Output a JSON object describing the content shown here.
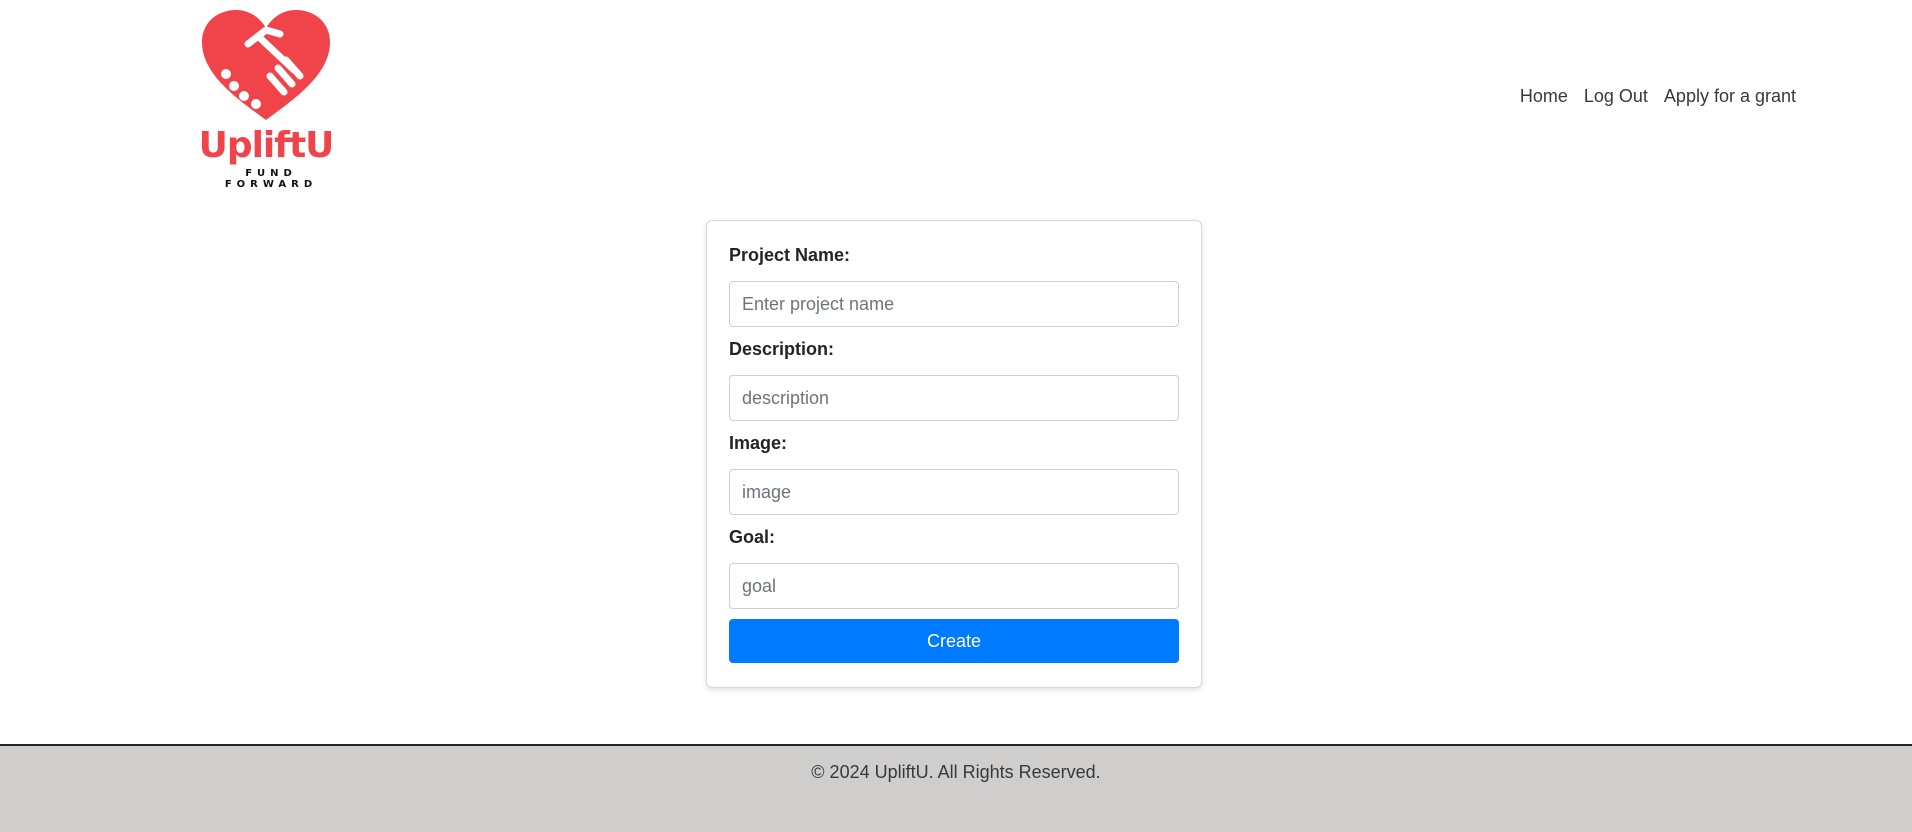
{
  "brand": {
    "name": "UpliftU",
    "tagline_line1": "FUND",
    "tagline_line2": "FORWARD",
    "color": "#f0444a"
  },
  "nav": {
    "items": [
      {
        "label": "Home"
      },
      {
        "label": "Log Out"
      },
      {
        "label": "Apply for a grant"
      }
    ]
  },
  "form": {
    "fields": [
      {
        "label": "Project Name:",
        "placeholder": "Enter project name",
        "value": ""
      },
      {
        "label": "Description:",
        "placeholder": "description",
        "value": ""
      },
      {
        "label": "Image:",
        "placeholder": "image",
        "value": ""
      },
      {
        "label": "Goal:",
        "placeholder": "goal",
        "value": ""
      }
    ],
    "submit_label": "Create",
    "submit_color": "#007bff"
  },
  "footer": {
    "text": "© 2024 UpliftU. All Rights Reserved."
  }
}
